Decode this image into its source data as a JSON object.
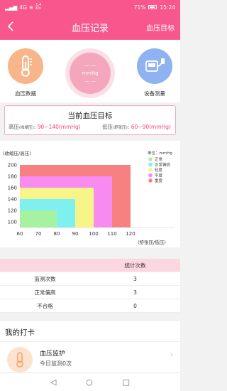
{
  "status": {
    "signal": "4G",
    "net_rate": "1.4\nK/s",
    "battery_pct": "71%",
    "time": "15:24"
  },
  "nav": {
    "back_icon": "chevron-left-icon",
    "title": "血压记录",
    "goal_label": "血压目标"
  },
  "top": {
    "left_label": "血压数据",
    "right_label": "设备测量",
    "ring_line1": "— —",
    "ring_unit": "mmHg",
    "ring_line3": "— —"
  },
  "target": {
    "title": "当前血压目标",
    "high_prefix": "高压",
    "high_paren": "(收缩压)",
    "high_value": "90~140(mmHg)",
    "low_prefix": "低压",
    "low_paren": "(舒张压)",
    "low_value": "60~90(mmHg)"
  },
  "chart_data": {
    "type": "area",
    "ylabel": "(收缩压/高压)",
    "xlabel": "(舒张压/低压)",
    "unit_label": "单位：mmHg",
    "x_ticks": [
      "60",
      "70",
      "80",
      "90",
      "100",
      "110",
      "120"
    ],
    "y_ticks": [
      "200",
      "180",
      "160",
      "140",
      "120",
      "100"
    ],
    "xlim": [
      60,
      120
    ],
    "ylim": [
      90,
      200
    ],
    "legend": [
      {
        "name": "正常",
        "color": "#a6f2a0"
      },
      {
        "name": "正常偏高",
        "color": "#7ff0f0"
      },
      {
        "name": "轻度",
        "color": "#f7f58a"
      },
      {
        "name": "中度",
        "color": "#f78bf0"
      },
      {
        "name": "重度",
        "color": "#f78080"
      }
    ],
    "zones": [
      {
        "name": "重度",
        "x_max": 120,
        "y_max": 200,
        "color": "#f78080"
      },
      {
        "name": "中度",
        "x_max": 110,
        "y_max": 180,
        "color": "#f78bf0"
      },
      {
        "name": "轻度",
        "x_max": 100,
        "y_max": 160,
        "color": "#f7f58a"
      },
      {
        "name": "正常偏高",
        "x_max": 90,
        "y_max": 140,
        "color": "#7ff0f0"
      },
      {
        "name": "正常",
        "x_max": 80,
        "y_max": 120,
        "color": "#a6f2a0"
      }
    ]
  },
  "table": {
    "header": [
      "",
      "统计次数"
    ],
    "rows": [
      {
        "label": "监测次数",
        "value": "3"
      },
      {
        "label": "正常偏高",
        "value": "3"
      },
      {
        "label": "不合格",
        "value": "0"
      }
    ]
  },
  "checkin": {
    "title": "我的打卡",
    "item_title": "血压监护",
    "item_sub": "今日监测0次"
  },
  "bottom_nav": {
    "back": "◁",
    "home": "○",
    "recent": "□"
  },
  "colors": {
    "brand": "#f7578c"
  }
}
